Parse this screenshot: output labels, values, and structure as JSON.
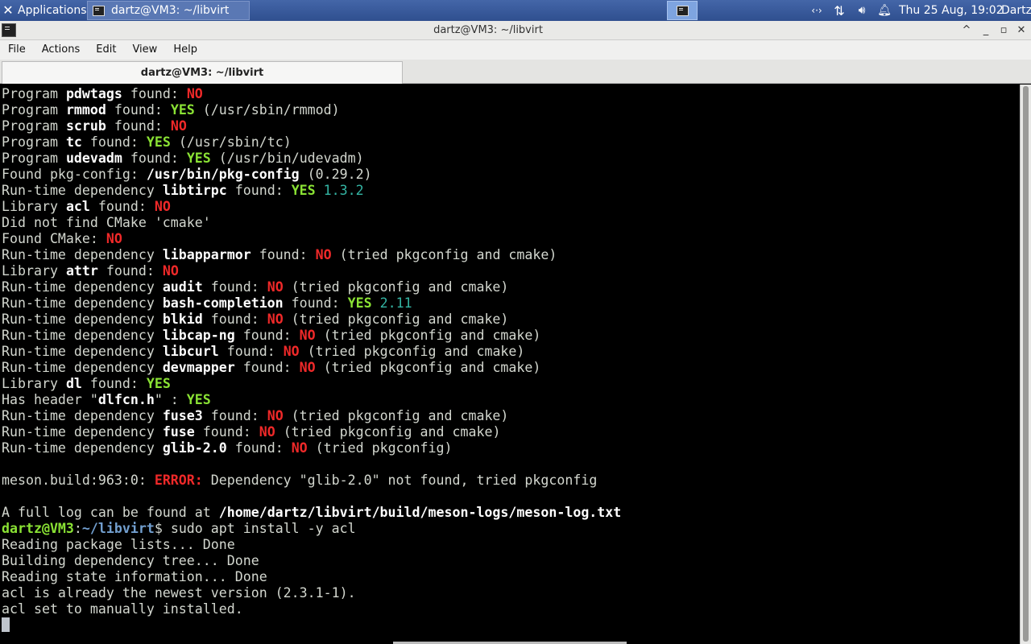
{
  "panel": {
    "applications_label": "Applications",
    "task_label": "dartz@VM3: ~/libvirt",
    "clock": "Thu 25 Aug, 19:02",
    "user": "Dartz"
  },
  "window": {
    "title": "dartz@VM3: ~/libvirt",
    "buttons": {
      "minimize": "^",
      "minimize2": "_",
      "maximize": "▫",
      "close": "✕"
    }
  },
  "menu": {
    "file": "File",
    "actions": "Actions",
    "edit": "Edit",
    "view": "View",
    "help": "Help"
  },
  "tab": {
    "label": "dartz@VM3: ~/libvirt"
  },
  "terminal": {
    "lines": [
      [
        [
          "Program ",
          ""
        ],
        [
          "pdwtags",
          "b"
        ],
        [
          " found: ",
          ""
        ],
        [
          "NO",
          "r"
        ]
      ],
      [
        [
          "Program ",
          ""
        ],
        [
          "rmmod",
          "b"
        ],
        [
          " found: ",
          ""
        ],
        [
          "YES",
          "g"
        ],
        [
          " (/usr/sbin/rmmod)",
          ""
        ]
      ],
      [
        [
          "Program ",
          ""
        ],
        [
          "scrub",
          "b"
        ],
        [
          " found: ",
          ""
        ],
        [
          "NO",
          "r"
        ]
      ],
      [
        [
          "Program ",
          ""
        ],
        [
          "tc",
          "b"
        ],
        [
          " found: ",
          ""
        ],
        [
          "YES",
          "g"
        ],
        [
          " (/usr/sbin/tc)",
          ""
        ]
      ],
      [
        [
          "Program ",
          ""
        ],
        [
          "udevadm",
          "b"
        ],
        [
          " found: ",
          ""
        ],
        [
          "YES",
          "g"
        ],
        [
          " (/usr/bin/udevadm)",
          ""
        ]
      ],
      [
        [
          "Found pkg-config: ",
          ""
        ],
        [
          "/usr/bin/pkg-config",
          "b"
        ],
        [
          " (0.29.2)",
          ""
        ]
      ],
      [
        [
          "Run-time dependency ",
          ""
        ],
        [
          "libtirpc",
          "b"
        ],
        [
          " found: ",
          ""
        ],
        [
          "YES",
          "g"
        ],
        [
          " ",
          ""
        ],
        [
          "1.3.2",
          "c"
        ]
      ],
      [
        [
          "Library ",
          ""
        ],
        [
          "acl",
          "b"
        ],
        [
          " found: ",
          ""
        ],
        [
          "NO",
          "r"
        ]
      ],
      [
        [
          "Did not find CMake 'cmake'",
          ""
        ]
      ],
      [
        [
          "Found CMake: ",
          ""
        ],
        [
          "NO",
          "r"
        ]
      ],
      [
        [
          "Run-time dependency ",
          ""
        ],
        [
          "libapparmor",
          "b"
        ],
        [
          " found: ",
          ""
        ],
        [
          "NO",
          "r"
        ],
        [
          " (tried pkgconfig and cmake)",
          ""
        ]
      ],
      [
        [
          "Library ",
          ""
        ],
        [
          "attr",
          "b"
        ],
        [
          " found: ",
          ""
        ],
        [
          "NO",
          "r"
        ]
      ],
      [
        [
          "Run-time dependency ",
          ""
        ],
        [
          "audit",
          "b"
        ],
        [
          " found: ",
          ""
        ],
        [
          "NO",
          "r"
        ],
        [
          " (tried pkgconfig and cmake)",
          ""
        ]
      ],
      [
        [
          "Run-time dependency ",
          ""
        ],
        [
          "bash-completion",
          "b"
        ],
        [
          " found: ",
          ""
        ],
        [
          "YES",
          "g"
        ],
        [
          " ",
          ""
        ],
        [
          "2.11",
          "c"
        ]
      ],
      [
        [
          "Run-time dependency ",
          ""
        ],
        [
          "blkid",
          "b"
        ],
        [
          " found: ",
          ""
        ],
        [
          "NO",
          "r"
        ],
        [
          " (tried pkgconfig and cmake)",
          ""
        ]
      ],
      [
        [
          "Run-time dependency ",
          ""
        ],
        [
          "libcap-ng",
          "b"
        ],
        [
          " found: ",
          ""
        ],
        [
          "NO",
          "r"
        ],
        [
          " (tried pkgconfig and cmake)",
          ""
        ]
      ],
      [
        [
          "Run-time dependency ",
          ""
        ],
        [
          "libcurl",
          "b"
        ],
        [
          " found: ",
          ""
        ],
        [
          "NO",
          "r"
        ],
        [
          " (tried pkgconfig and cmake)",
          ""
        ]
      ],
      [
        [
          "Run-time dependency ",
          ""
        ],
        [
          "devmapper",
          "b"
        ],
        [
          " found: ",
          ""
        ],
        [
          "NO",
          "r"
        ],
        [
          " (tried pkgconfig and cmake)",
          ""
        ]
      ],
      [
        [
          "Library ",
          ""
        ],
        [
          "dl",
          "b"
        ],
        [
          " found: ",
          ""
        ],
        [
          "YES",
          "g"
        ]
      ],
      [
        [
          "Has header \"",
          ""
        ],
        [
          "dlfcn.h",
          "b"
        ],
        [
          "\" : ",
          ""
        ],
        [
          "YES",
          "g"
        ]
      ],
      [
        [
          "Run-time dependency ",
          ""
        ],
        [
          "fuse3",
          "b"
        ],
        [
          " found: ",
          ""
        ],
        [
          "NO",
          "r"
        ],
        [
          " (tried pkgconfig and cmake)",
          ""
        ]
      ],
      [
        [
          "Run-time dependency ",
          ""
        ],
        [
          "fuse",
          "b"
        ],
        [
          " found: ",
          ""
        ],
        [
          "NO",
          "r"
        ],
        [
          " (tried pkgconfig and cmake)",
          ""
        ]
      ],
      [
        [
          "Run-time dependency ",
          ""
        ],
        [
          "glib-2.0",
          "b"
        ],
        [
          " found: ",
          ""
        ],
        [
          "NO",
          "r"
        ],
        [
          " (tried pkgconfig)",
          ""
        ]
      ],
      [],
      [
        [
          "meson.build:963:0: ",
          ""
        ],
        [
          "ERROR:",
          "r"
        ],
        [
          " Dependency \"glib-2.0\" not found, tried pkgconfig",
          ""
        ]
      ],
      [],
      [
        [
          "A full log can be found at ",
          ""
        ],
        [
          "/home/dartz/libvirt/build/meson-logs/meson-log.txt",
          "b"
        ]
      ],
      [
        [
          "dartz@VM3",
          "pg"
        ],
        [
          ":",
          ""
        ],
        [
          "~/libvirt",
          "pb"
        ],
        [
          "$ sudo apt install -y acl",
          ""
        ]
      ],
      [
        [
          "Reading package lists... Done",
          ""
        ]
      ],
      [
        [
          "Building dependency tree... Done",
          ""
        ]
      ],
      [
        [
          "Reading state information... Done",
          ""
        ]
      ],
      [
        [
          "acl is already the newest version (2.3.1-1).",
          ""
        ]
      ],
      [
        [
          "acl set to manually installed.",
          ""
        ]
      ]
    ]
  }
}
